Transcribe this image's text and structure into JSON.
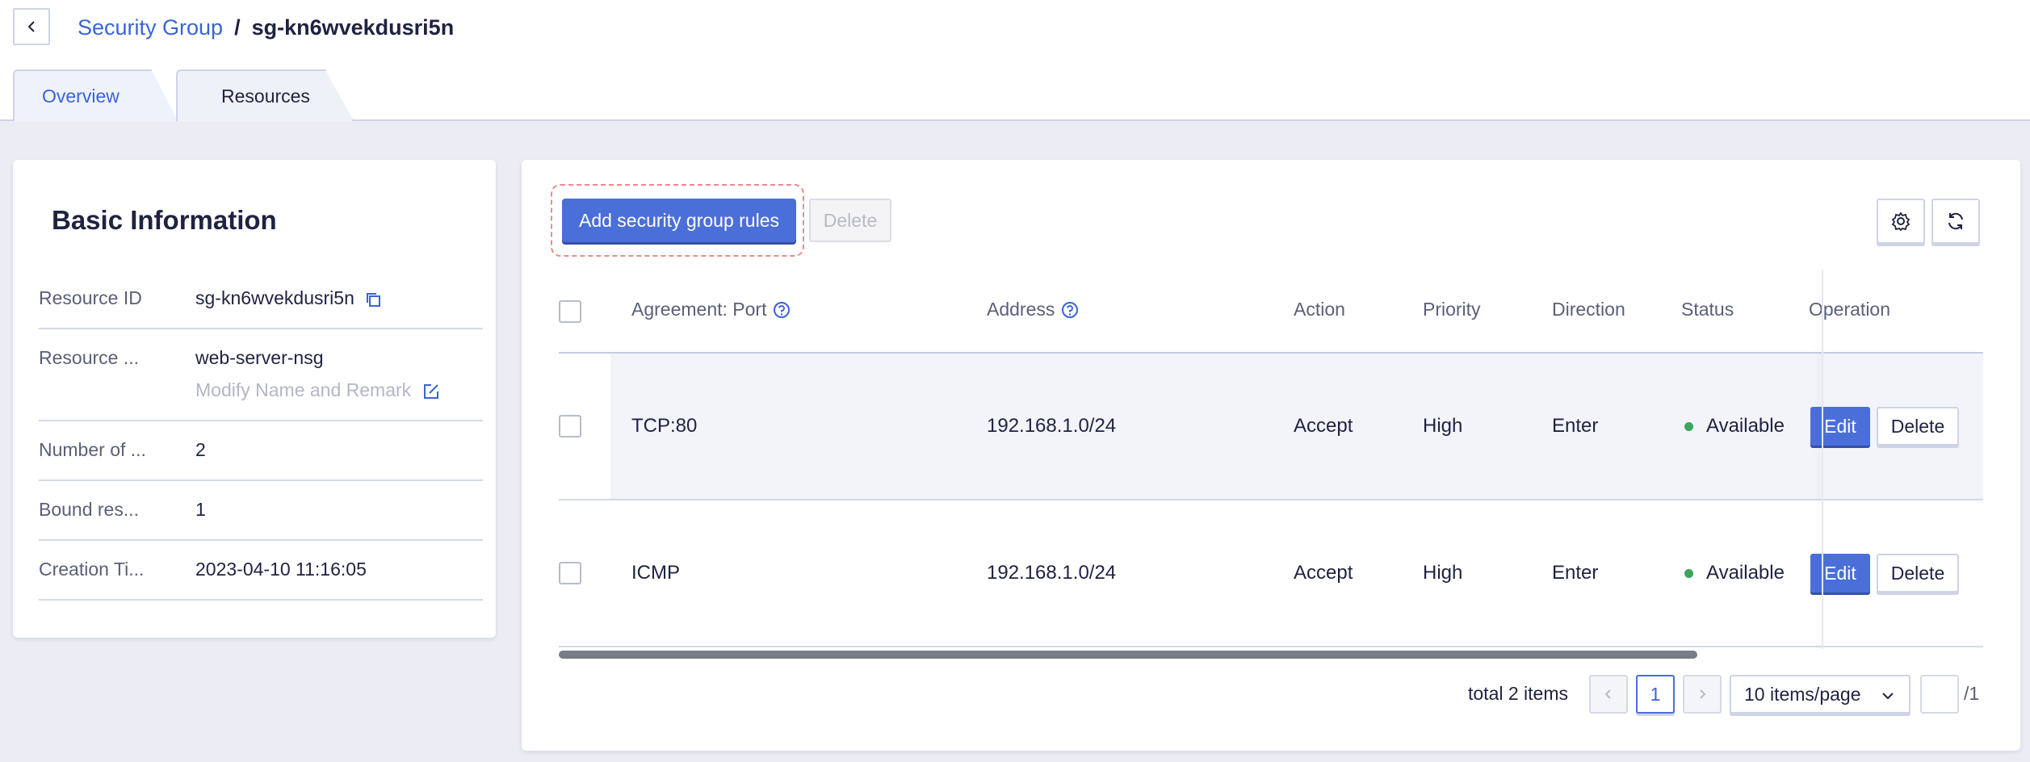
{
  "header": {
    "breadcrumb_parent": "Security Group",
    "breadcrumb_separator": "/",
    "breadcrumb_current": "sg-kn6wvekdusri5n"
  },
  "tabs": [
    {
      "label": "Overview",
      "active": true
    },
    {
      "label": "Resources",
      "active": false
    }
  ],
  "basic_info": {
    "title": "Basic Information",
    "rows": [
      {
        "label": "Resource ID",
        "value": "sg-kn6wvekdusri5n"
      },
      {
        "label": "Resource ...",
        "value": "web-server-nsg",
        "sub": "Modify Name and Remark"
      },
      {
        "label": "Number of ...",
        "value": "2"
      },
      {
        "label": "Bound res...",
        "value": "1"
      },
      {
        "label": "Creation Ti...",
        "value": "2023-04-10 11:16:05"
      }
    ]
  },
  "toolbar": {
    "add_label": "Add security group rules",
    "delete_label": "Delete"
  },
  "table": {
    "columns": [
      "Agreement: Port",
      "Address",
      "Action",
      "Priority",
      "Direction",
      "Status",
      "Operation"
    ],
    "rows": [
      {
        "port": "TCP:80",
        "address": "192.168.1.0/24",
        "action": "Accept",
        "priority": "High",
        "direction": "Enter",
        "status": "Available",
        "edit": "Edit",
        "delete": "Delete"
      },
      {
        "port": "ICMP",
        "address": "192.168.1.0/24",
        "action": "Accept",
        "priority": "High",
        "direction": "Enter",
        "status": "Available",
        "edit": "Edit",
        "delete": "Delete"
      }
    ]
  },
  "pagination": {
    "total_text": "total 2 items",
    "current_page": "1",
    "page_size": "10 items/page",
    "total_pages": "/1"
  },
  "colors": {
    "accent": "#4a6fd8",
    "status_available": "#3ba55c",
    "highlight_dashed": "#f0888c"
  }
}
